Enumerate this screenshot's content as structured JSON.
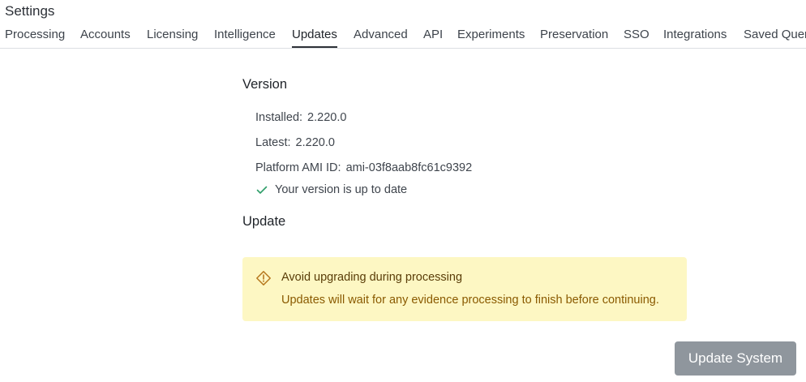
{
  "header": {
    "title": "Settings"
  },
  "tabs": [
    {
      "label": "Processing"
    },
    {
      "label": "Accounts"
    },
    {
      "label": "Licensing"
    },
    {
      "label": "Intelligence"
    },
    {
      "label": "Updates",
      "active": true
    },
    {
      "label": "Advanced"
    },
    {
      "label": "API"
    },
    {
      "label": "Experiments"
    },
    {
      "label": "Preservation"
    },
    {
      "label": "SSO"
    },
    {
      "label": "Integrations"
    },
    {
      "label": "Saved Quer"
    }
  ],
  "version": {
    "heading": "Version",
    "installed_label": "Installed:",
    "installed_value": "2.220.0",
    "latest_label": "Latest:",
    "latest_value": "2.220.0",
    "ami_label": "Platform AMI ID:",
    "ami_value": "ami-03f8aab8fc61c9392",
    "status_text": "Your version is up to date",
    "status_icon": "check-icon",
    "status_color": "#2f9e6a"
  },
  "update": {
    "heading": "Update",
    "alert": {
      "icon": "warning-icon",
      "title": "Avoid upgrading during processing",
      "body": "Updates will wait for any evidence processing to finish before continuing.",
      "background": "#fdf7c3",
      "accent": "#b7791f"
    },
    "button_label": "Update System",
    "button_color": "#8f969d"
  }
}
